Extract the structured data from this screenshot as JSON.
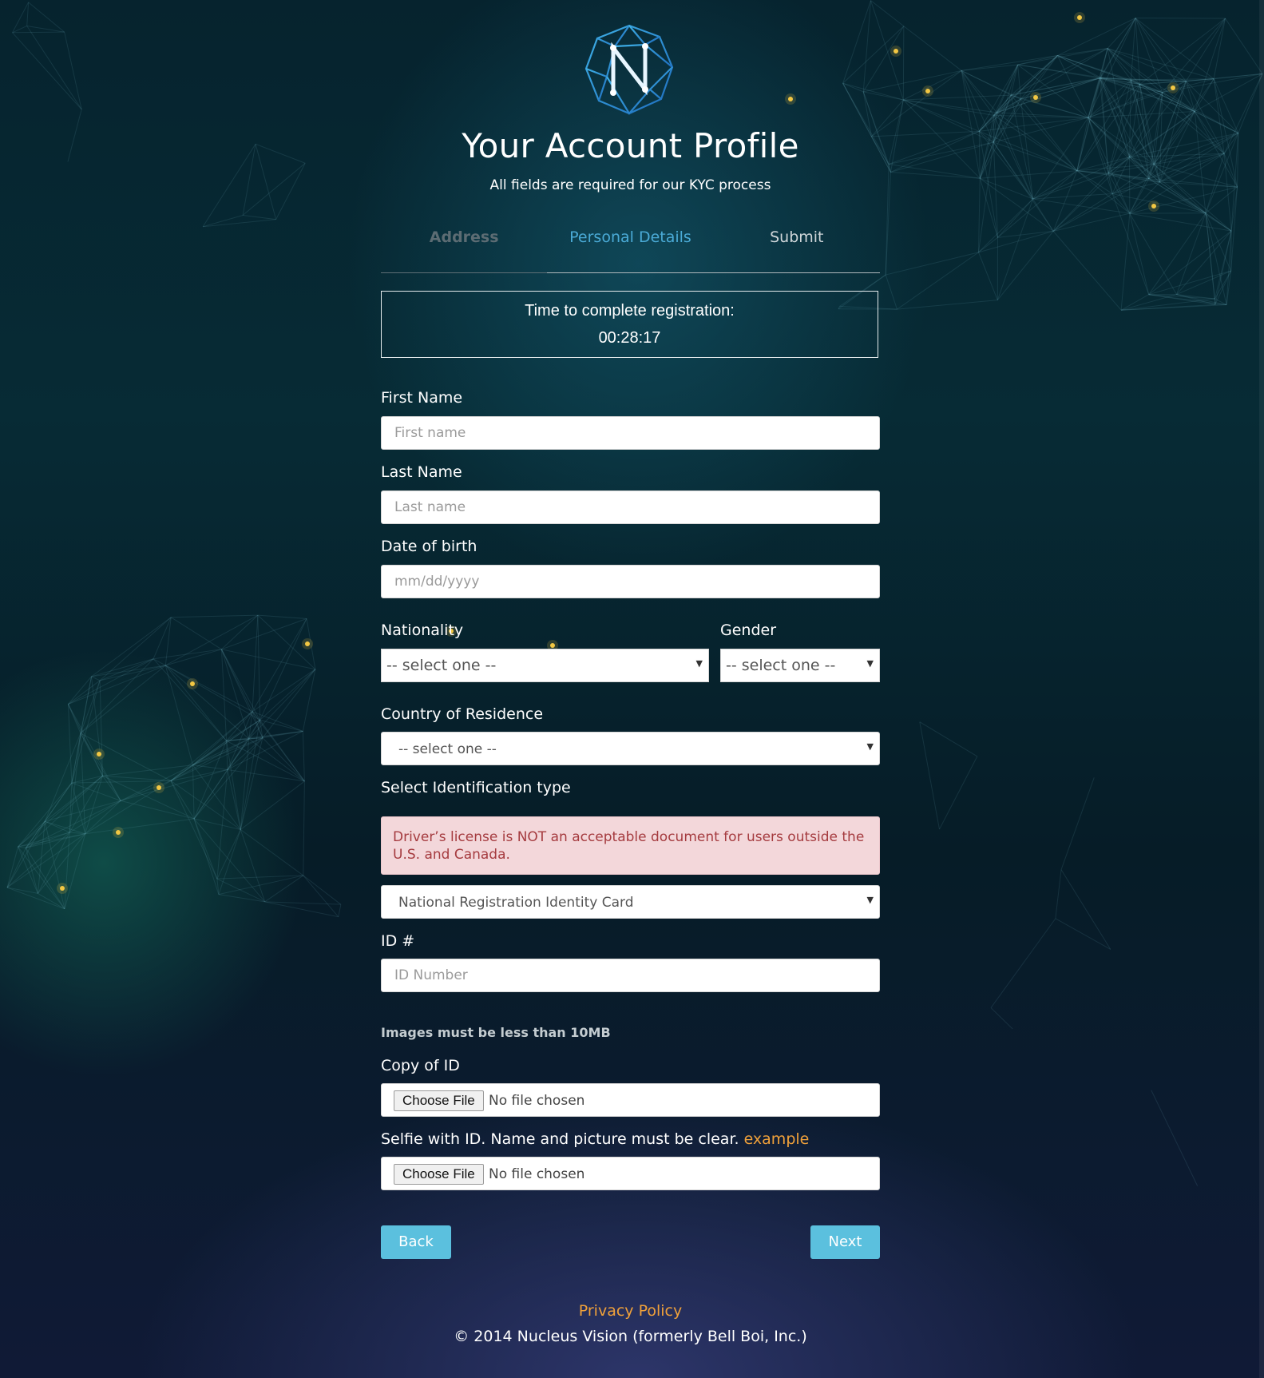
{
  "header": {
    "title": "Your Account Profile",
    "subtitle": "All fields are required for our KYC process"
  },
  "steps": [
    {
      "label": "Address",
      "state": "completed"
    },
    {
      "label": "Personal Details",
      "state": "active"
    },
    {
      "label": "Submit",
      "state": "pending"
    }
  ],
  "timer": {
    "label": "Time to complete registration:",
    "value": "00:28:17"
  },
  "form": {
    "first_name": {
      "label": "First Name",
      "placeholder": "First name",
      "value": ""
    },
    "last_name": {
      "label": "Last Name",
      "placeholder": "Last name",
      "value": ""
    },
    "dob": {
      "label": "Date of birth",
      "placeholder": "mm/dd/yyyy",
      "value": ""
    },
    "nationality": {
      "label": "Nationality",
      "selected": "-- select one --"
    },
    "gender": {
      "label": "Gender",
      "selected": "-- select one --"
    },
    "country": {
      "label": "Country of Residence",
      "selected": "-- select one --"
    },
    "id_type": {
      "label": "Select Identification type",
      "alert": "Driver’s license is NOT an acceptable document for users outside the U.S. and Canada.",
      "selected": "National Registration Identity Card"
    },
    "id_number": {
      "label": "ID #",
      "placeholder": "ID Number",
      "value": ""
    },
    "images_note": "Images must be less than 10MB",
    "copy_of_id": {
      "label": "Copy of ID",
      "button": "Choose File",
      "status": "No file chosen"
    },
    "selfie": {
      "label": "Selfie with ID. Name and picture must be clear.",
      "link": "example",
      "button": "Choose File",
      "status": "No file chosen"
    }
  },
  "actions": {
    "back": "Back",
    "next": "Next"
  },
  "footer": {
    "privacy": "Privacy Policy",
    "copyright": "© 2014 Nucleus Vision (formerly Bell Boi, Inc.)"
  },
  "colors": {
    "accent": "#5bc0de",
    "active_step": "#4aaad6",
    "link": "#f0a13a",
    "alert_bg": "#f3d7da",
    "alert_text": "#a53b3f"
  }
}
